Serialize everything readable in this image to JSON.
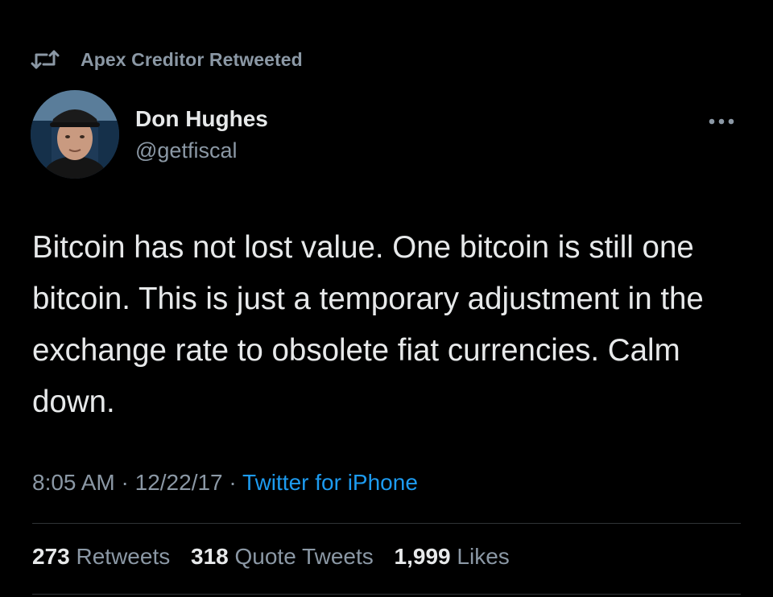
{
  "retweet_context": {
    "label": "Apex Creditor Retweeted",
    "icon": "retweet-icon"
  },
  "author": {
    "display_name": "Don Hughes",
    "handle": "@getfiscal",
    "avatar_icon": "avatar-photo"
  },
  "more_menu": {
    "icon": "more-options-icon"
  },
  "tweet": {
    "text": "Bitcoin has not lost value. One bitcoin is still one bitcoin. This is just a temporary adjustment in the exchange rate to obsolete fiat currencies. Calm down."
  },
  "meta": {
    "time": "8:05 AM",
    "separator": " · ",
    "date": "12/22/17",
    "source": "Twitter for iPhone"
  },
  "stats": {
    "retweets_count": "273",
    "retweets_label": "Retweets",
    "quotes_count": "318",
    "quotes_label": "Quote Tweets",
    "likes_count": "1,999",
    "likes_label": "Likes"
  },
  "colors": {
    "background": "#000000",
    "primary_text": "#e7e9ea",
    "secondary_text": "#8b98a5",
    "link": "#1d9bf0",
    "divider": "#2f3336"
  }
}
